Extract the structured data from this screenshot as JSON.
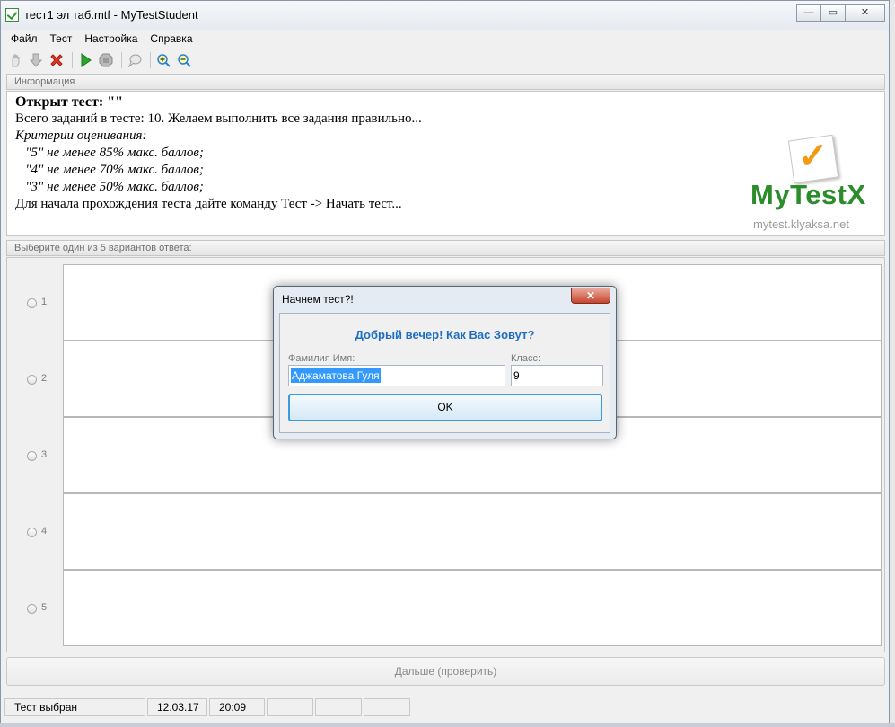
{
  "window": {
    "title": "тест1 эл таб.mtf - MyTestStudent",
    "controls": {
      "minimize": "—",
      "maximize": "▭",
      "close": "✕"
    }
  },
  "menu": [
    "Файл",
    "Тест",
    "Настройка",
    "Справка"
  ],
  "toolbar": [
    "hand-icon",
    "down-arrow-icon",
    "delete-x-icon",
    "play-icon",
    "stop-icon",
    "speech-bubble-icon",
    "zoom-in-icon",
    "zoom-out-icon"
  ],
  "info": {
    "header": "Информация",
    "lines": [
      "Открыт тест: \"\"",
      "Всего заданий в тесте: 10. Желаем выполнить все задания правильно...",
      "Критерии оценивания:",
      "   \"5\" не менее 85% макс. баллов;",
      "   \"4\" не менее 70% макс. баллов;",
      "   \"3\" не менее 50% макс. баллов;",
      "Для начала прохождения теста дайте команду Тест -> Начать тест..."
    ],
    "logo": {
      "brand": "MyTestX",
      "url": "mytest.klyaksa.net"
    }
  },
  "answers": {
    "header": "Выберите один из 5 вариантов ответа:",
    "options": [
      "1",
      "2",
      "3",
      "4",
      "5"
    ]
  },
  "next_button": "Дальше (проверить)",
  "status": {
    "state": "Тест выбран",
    "date": "12.03.17",
    "time": "20:09"
  },
  "dialog": {
    "title": "Начнем тест?!",
    "close": "✕",
    "greeting": "Добрый вечер! Как Вас Зовут?",
    "name_label": "Фамилия Имя:",
    "name_value": "Аджаматова Гуля",
    "class_label": "Класс:",
    "class_value": "9",
    "ok": "OK"
  },
  "colors": {
    "greeting": "#1e6fc2",
    "logo_green": "#2a8d2a",
    "logo_check": "#f29a12"
  }
}
